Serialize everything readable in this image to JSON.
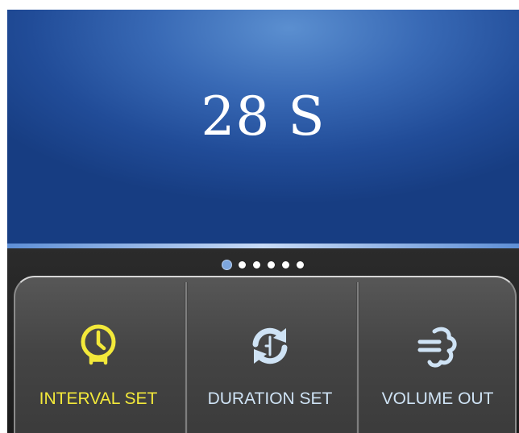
{
  "display": {
    "readout": "28 S"
  },
  "pager": {
    "count": 6,
    "active_index": 0
  },
  "tiles": [
    {
      "label": "INTERVAL SET",
      "icon": "clock-icon",
      "color": "#f3e93a",
      "selected": true
    },
    {
      "label": "DURATION SET",
      "icon": "refresh-timer-icon",
      "color": "#cfe3f5",
      "selected": false
    },
    {
      "label": "VOLUME OUT",
      "icon": "spray-cloud-icon",
      "color": "#cfe3f5",
      "selected": false
    }
  ],
  "colors": {
    "display_blue": "#2c5aa6",
    "accent_yellow": "#f3e93a",
    "icon_light_blue": "#cfe3f5",
    "panel_gray": "#444444"
  }
}
